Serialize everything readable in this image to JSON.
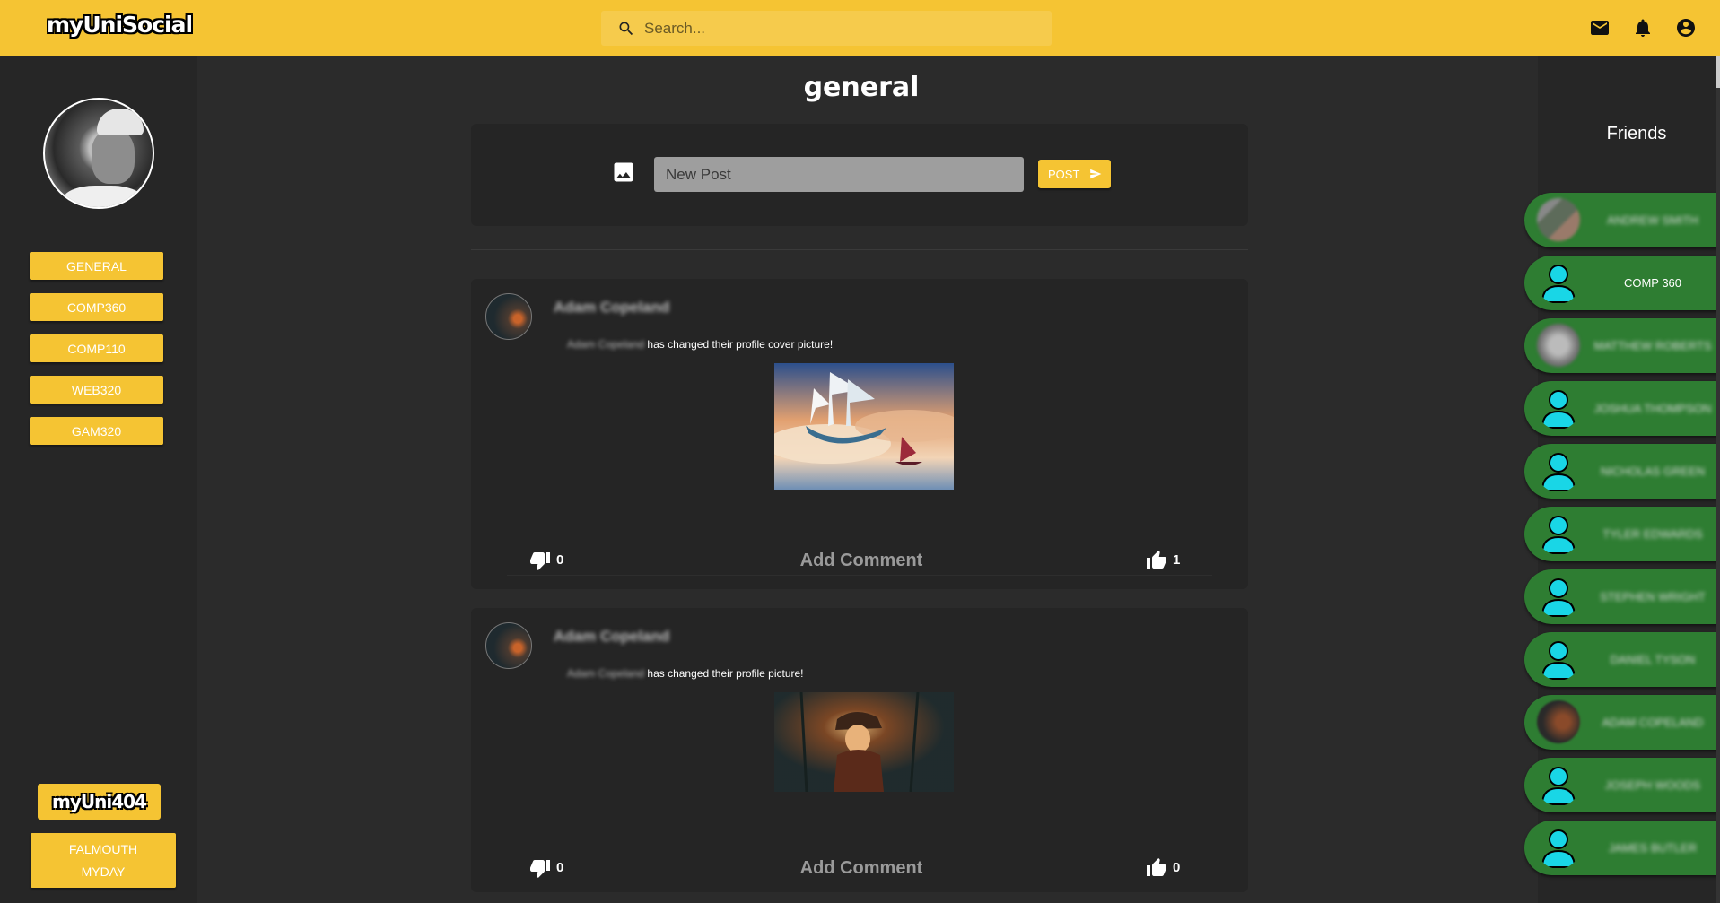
{
  "app": {
    "logo": "myUniSocial"
  },
  "header": {
    "search_placeholder": "Search..."
  },
  "sidebar": {
    "channels": [
      {
        "label": "GENERAL"
      },
      {
        "label": "COMP360"
      },
      {
        "label": "COMP110"
      },
      {
        "label": "WEB320"
      },
      {
        "label": "GAM320"
      }
    ],
    "footer_logo": "myUni404",
    "falmouth_line1": "FALMOUTH",
    "falmouth_line2": "MYDAY"
  },
  "main": {
    "title": "general",
    "composer": {
      "placeholder": "New Post",
      "post_label": "POST"
    },
    "posts": [
      {
        "author": "Adam Copeland",
        "actor": "Adam Copeland",
        "activity": "has changed their profile cover picture!",
        "dislikes": "0",
        "likes": "1",
        "comment_label": "Add Comment",
        "image": "flying-ships-painting"
      },
      {
        "author": "Adam Copeland",
        "actor": "Adam Copeland",
        "activity": "has changed their profile picture!",
        "dislikes": "0",
        "likes": "0",
        "comment_label": "Add Comment",
        "image": "pirate-captain-painting"
      }
    ]
  },
  "friends": {
    "title": "Friends",
    "items": [
      {
        "name": "ANDREW SMITH",
        "avatar": "photo"
      },
      {
        "name": "COMP 360",
        "avatar": "default"
      },
      {
        "name": "MATTHEW ROBERTS",
        "avatar": "photo"
      },
      {
        "name": "JOSHUA THOMPSON",
        "avatar": "default"
      },
      {
        "name": "NICHOLAS GREEN",
        "avatar": "default"
      },
      {
        "name": "TYLER EDWARDS",
        "avatar": "default"
      },
      {
        "name": "STEPHEN WRIGHT",
        "avatar": "default"
      },
      {
        "name": "DANIEL TYSON",
        "avatar": "default"
      },
      {
        "name": "ADAM COPELAND",
        "avatar": "photo"
      },
      {
        "name": "JOSEPH WOODS",
        "avatar": "default"
      },
      {
        "name": "JAMES BUTLER",
        "avatar": "default"
      }
    ]
  },
  "colors": {
    "brand_yellow": "#f5c433",
    "friend_green": "#2e7d32",
    "avatar_cyan": "#19d6e6"
  },
  "icons": {
    "search": "search-icon",
    "mail": "mail-icon",
    "bell": "bell-icon",
    "account": "account-circle-icon",
    "image": "image-icon",
    "send": "send-icon",
    "thumb_down": "thumb-down-icon",
    "thumb_up": "thumb-up-icon"
  }
}
